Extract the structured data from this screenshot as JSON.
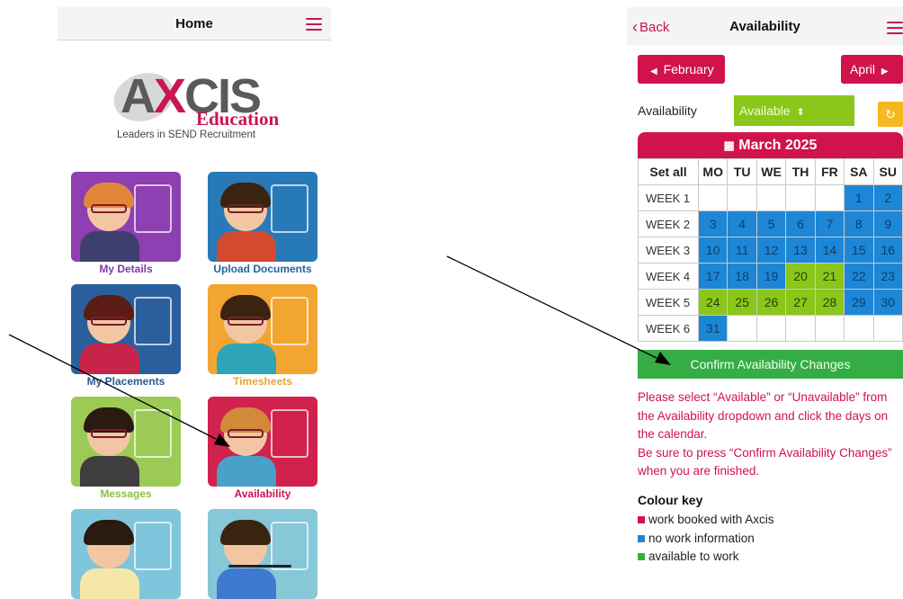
{
  "left": {
    "header_title": "Home",
    "logo_text": "AXCIS",
    "logo_subtext": "Education",
    "logo_tagline": "Leaders in SEND Recruitment",
    "tiles": [
      {
        "label": "My Details",
        "bg": "#8e3fb1",
        "label_color": "#7e3aa6"
      },
      {
        "label": "Upload Documents",
        "bg": "#2879b8",
        "label_color": "#2365a0"
      },
      {
        "label": "My Placements",
        "bg": "#2a5f9d",
        "label_color": "#2a5a95"
      },
      {
        "label": "Timesheets",
        "bg": "#f2a531",
        "label_color": "#e9a52d"
      },
      {
        "label": "Messages",
        "bg": "#9ccb55",
        "label_color": "#8dbf48"
      },
      {
        "label": "Availability",
        "bg": "#d1214d",
        "label_color": "#c8174f"
      },
      {
        "label": "",
        "bg": "#7fc6dc",
        "label_color": "#555"
      },
      {
        "label": "",
        "bg": "#86c7d8",
        "label_color": "#555"
      }
    ]
  },
  "right": {
    "back_label": "Back",
    "header_title": "Availability",
    "prev_month": "February",
    "next_month": "April",
    "availability_label": "Availability",
    "availability_value": "Available",
    "calendar_title": "March 2025",
    "set_all": "Set all",
    "days": [
      "MO",
      "TU",
      "WE",
      "TH",
      "FR",
      "SA",
      "SU"
    ],
    "weeks": [
      {
        "label": "WEEK 1",
        "cells": [
          {
            "d": "",
            "s": "e"
          },
          {
            "d": "",
            "s": "e"
          },
          {
            "d": "",
            "s": "e"
          },
          {
            "d": "",
            "s": "e"
          },
          {
            "d": "",
            "s": "e"
          },
          {
            "d": "1",
            "s": "b"
          },
          {
            "d": "2",
            "s": "b"
          }
        ]
      },
      {
        "label": "WEEK 2",
        "cells": [
          {
            "d": "3",
            "s": "b"
          },
          {
            "d": "4",
            "s": "b"
          },
          {
            "d": "5",
            "s": "b"
          },
          {
            "d": "6",
            "s": "b"
          },
          {
            "d": "7",
            "s": "b"
          },
          {
            "d": "8",
            "s": "b"
          },
          {
            "d": "9",
            "s": "b"
          }
        ]
      },
      {
        "label": "WEEK 3",
        "cells": [
          {
            "d": "10",
            "s": "b"
          },
          {
            "d": "11",
            "s": "b"
          },
          {
            "d": "12",
            "s": "b"
          },
          {
            "d": "13",
            "s": "b"
          },
          {
            "d": "14",
            "s": "b"
          },
          {
            "d": "15",
            "s": "b"
          },
          {
            "d": "16",
            "s": "b"
          }
        ]
      },
      {
        "label": "WEEK 4",
        "cells": [
          {
            "d": "17",
            "s": "b"
          },
          {
            "d": "18",
            "s": "b"
          },
          {
            "d": "19",
            "s": "b"
          },
          {
            "d": "20",
            "s": "g"
          },
          {
            "d": "21",
            "s": "g"
          },
          {
            "d": "22",
            "s": "b"
          },
          {
            "d": "23",
            "s": "b"
          }
        ]
      },
      {
        "label": "WEEK 5",
        "cells": [
          {
            "d": "24",
            "s": "g"
          },
          {
            "d": "25",
            "s": "g"
          },
          {
            "d": "26",
            "s": "g"
          },
          {
            "d": "27",
            "s": "g"
          },
          {
            "d": "28",
            "s": "g"
          },
          {
            "d": "29",
            "s": "b"
          },
          {
            "d": "30",
            "s": "b"
          }
        ]
      },
      {
        "label": "WEEK 6",
        "cells": [
          {
            "d": "31",
            "s": "b"
          },
          {
            "d": "",
            "s": "e"
          },
          {
            "d": "",
            "s": "e"
          },
          {
            "d": "",
            "s": "e"
          },
          {
            "d": "",
            "s": "e"
          },
          {
            "d": "",
            "s": "e"
          },
          {
            "d": "",
            "s": "e"
          }
        ]
      }
    ],
    "confirm_label": "Confirm Availability Changes",
    "instructions_1": "Please select “Available” or “Unavailable” from the Availability dropdown and click the days on the calendar.",
    "instructions_2": "Be sure to press “Confirm Availability Changes” when you are finished.",
    "colour_key_title": "Colour key",
    "colour_key": [
      {
        "label": "work booked with Axcis",
        "color": "#d0134a"
      },
      {
        "label": "no work information",
        "color": "#1d86d6"
      },
      {
        "label": "available to work",
        "color": "#35ad45"
      }
    ]
  },
  "colors": {
    "brand": "#d0134a",
    "blue": "#1d86d6",
    "green": "#8bc61a",
    "confirm": "#35ad45"
  }
}
